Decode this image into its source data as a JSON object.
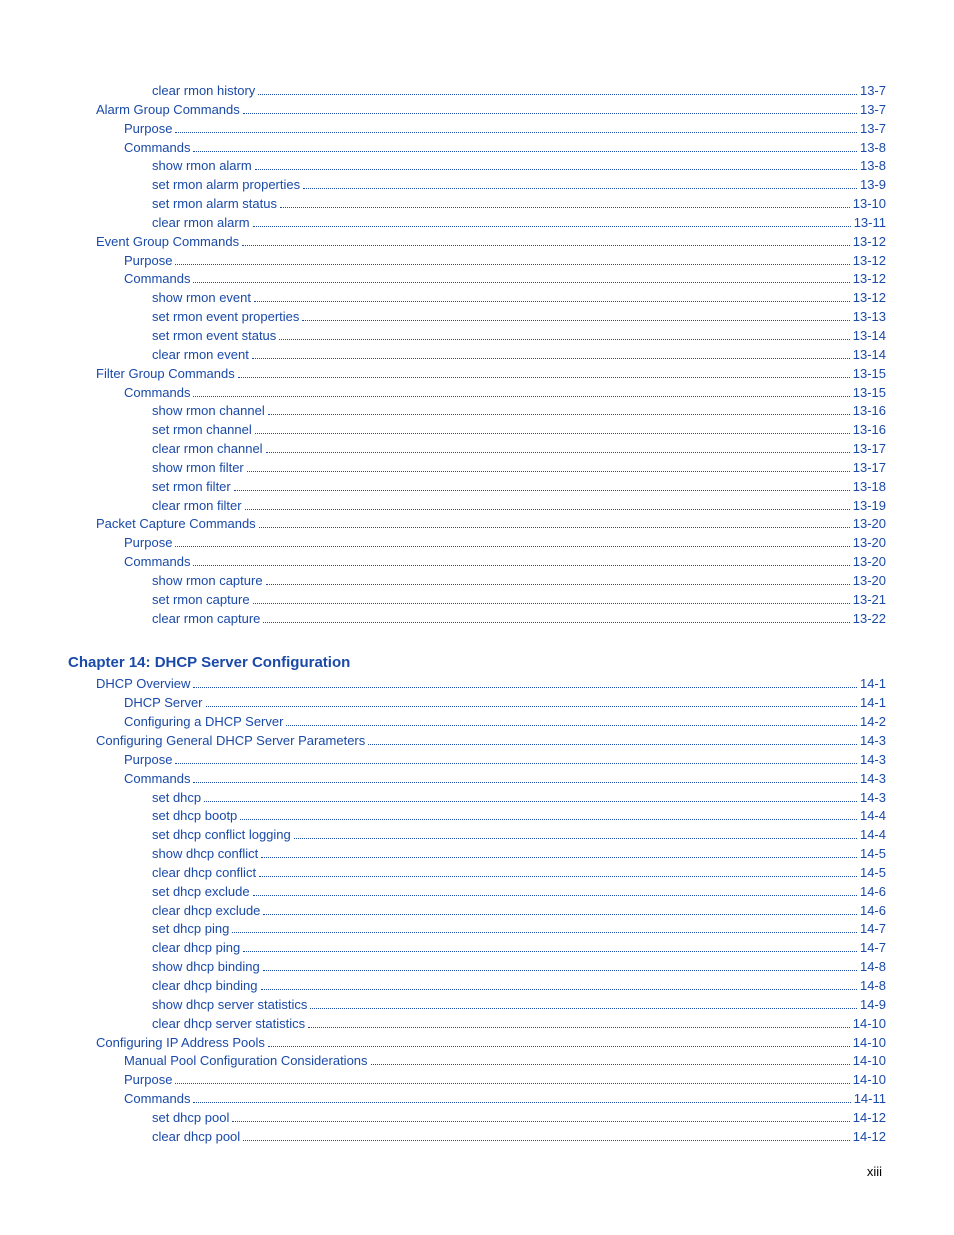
{
  "sections": [
    {
      "type": "toc",
      "entries": [
        {
          "indent": 3,
          "label": "clear rmon history",
          "page": "13-7"
        },
        {
          "indent": 1,
          "label": "Alarm Group Commands ",
          "page": "13-7"
        },
        {
          "indent": 2,
          "label": "Purpose",
          "page": "13-7"
        },
        {
          "indent": 2,
          "label": "Commands",
          "page": "13-8"
        },
        {
          "indent": 3,
          "label": "show rmon alarm",
          "page": "13-8"
        },
        {
          "indent": 3,
          "label": "set rmon alarm properties",
          "page": "13-9"
        },
        {
          "indent": 3,
          "label": "set rmon alarm status",
          "page": "13-10"
        },
        {
          "indent": 3,
          "label": "clear rmon alarm",
          "page": "13-11"
        },
        {
          "indent": 1,
          "label": "Event Group Commands ",
          "page": "13-12"
        },
        {
          "indent": 2,
          "label": "Purpose",
          "page": "13-12"
        },
        {
          "indent": 2,
          "label": "Commands",
          "page": "13-12"
        },
        {
          "indent": 3,
          "label": "show rmon event",
          "page": "13-12"
        },
        {
          "indent": 3,
          "label": "set rmon event properties",
          "page": "13-13"
        },
        {
          "indent": 3,
          "label": "set rmon event status",
          "page": "13-14"
        },
        {
          "indent": 3,
          "label": "clear rmon event",
          "page": "13-14"
        },
        {
          "indent": 1,
          "label": "Filter Group Commands ",
          "page": "13-15"
        },
        {
          "indent": 2,
          "label": "Commands",
          "page": "13-15"
        },
        {
          "indent": 3,
          "label": "show rmon channel",
          "page": "13-16"
        },
        {
          "indent": 3,
          "label": "set rmon channel",
          "page": "13-16"
        },
        {
          "indent": 3,
          "label": "clear rmon channel",
          "page": "13-17"
        },
        {
          "indent": 3,
          "label": "show rmon filter",
          "page": "13-17"
        },
        {
          "indent": 3,
          "label": "set rmon filter",
          "page": "13-18"
        },
        {
          "indent": 3,
          "label": "clear rmon filter",
          "page": "13-19"
        },
        {
          "indent": 1,
          "label": "Packet Capture Commands ",
          "page": "13-20"
        },
        {
          "indent": 2,
          "label": "Purpose",
          "page": "13-20"
        },
        {
          "indent": 2,
          "label": "Commands",
          "page": "13-20"
        },
        {
          "indent": 3,
          "label": "show rmon capture",
          "page": "13-20"
        },
        {
          "indent": 3,
          "label": "set rmon capture",
          "page": "13-21"
        },
        {
          "indent": 3,
          "label": "clear rmon capture",
          "page": "13-22"
        }
      ]
    },
    {
      "type": "chapter",
      "title": "Chapter 14: DHCP Server Configuration"
    },
    {
      "type": "toc",
      "entries": [
        {
          "indent": 1,
          "label": "DHCP Overview ",
          "page": "14-1"
        },
        {
          "indent": 2,
          "label": "DHCP Server ",
          "page": "14-1"
        },
        {
          "indent": 2,
          "label": "Configuring a DHCP Server ",
          "page": "14-2"
        },
        {
          "indent": 1,
          "label": "Configuring General DHCP Server Parameters ",
          "page": "14-3"
        },
        {
          "indent": 2,
          "label": "Purpose",
          "page": "14-3"
        },
        {
          "indent": 2,
          "label": "Commands",
          "page": "14-3"
        },
        {
          "indent": 3,
          "label": "set dhcp",
          "page": "14-3"
        },
        {
          "indent": 3,
          "label": "set dhcp bootp",
          "page": "14-4"
        },
        {
          "indent": 3,
          "label": "set dhcp conflict logging",
          "page": "14-4"
        },
        {
          "indent": 3,
          "label": "show dhcp conflict",
          "page": "14-5"
        },
        {
          "indent": 3,
          "label": "clear dhcp conflict",
          "page": "14-5"
        },
        {
          "indent": 3,
          "label": "set dhcp exclude",
          "page": "14-6"
        },
        {
          "indent": 3,
          "label": "clear dhcp exclude",
          "page": "14-6"
        },
        {
          "indent": 3,
          "label": "set dhcp ping",
          "page": "14-7"
        },
        {
          "indent": 3,
          "label": "clear dhcp ping",
          "page": "14-7"
        },
        {
          "indent": 3,
          "label": "show dhcp binding",
          "page": "14-8"
        },
        {
          "indent": 3,
          "label": "clear dhcp binding",
          "page": "14-8"
        },
        {
          "indent": 3,
          "label": "show dhcp server statistics",
          "page": "14-9"
        },
        {
          "indent": 3,
          "label": "clear dhcp server statistics",
          "page": "14-10"
        },
        {
          "indent": 1,
          "label": "Configuring IP Address Pools ",
          "page": "14-10"
        },
        {
          "indent": 2,
          "label": "Manual Pool Configuration Considerations ",
          "page": "14-10"
        },
        {
          "indent": 2,
          "label": "Purpose",
          "page": "14-10"
        },
        {
          "indent": 2,
          "label": "Commands",
          "page": "14-11"
        },
        {
          "indent": 3,
          "label": "set dhcp pool",
          "page": "14-12"
        },
        {
          "indent": 3,
          "label": "clear dhcp pool",
          "page": "14-12"
        }
      ]
    }
  ],
  "page_number": "xiii"
}
